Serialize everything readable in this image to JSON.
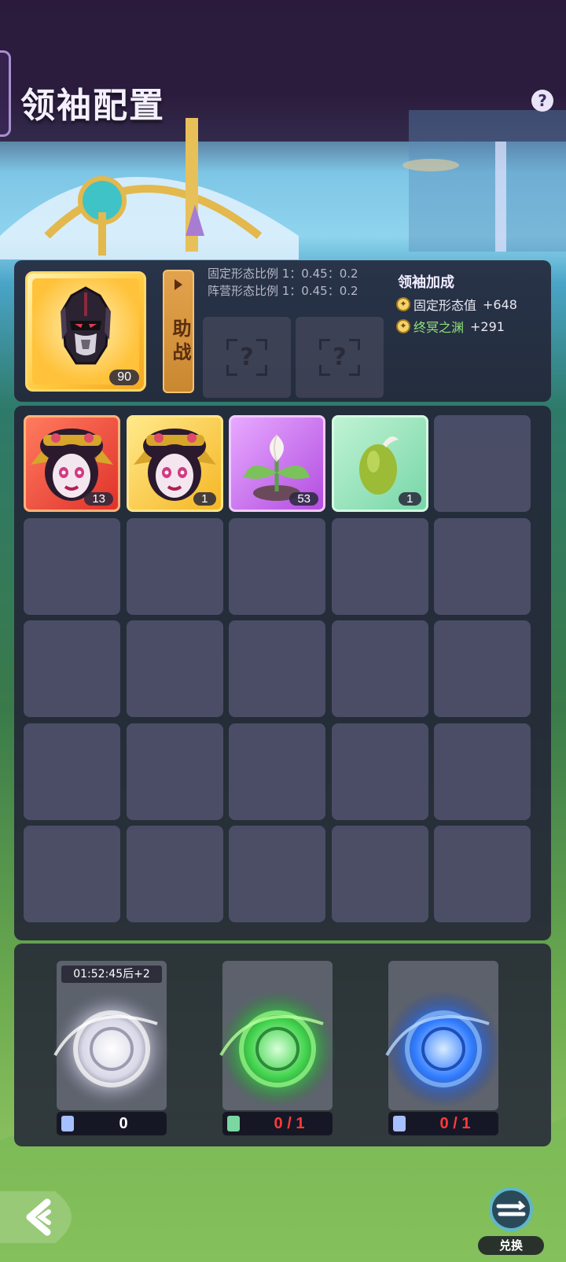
{
  "header": {
    "title": "领袖配置",
    "help_symbol": "?"
  },
  "leader": {
    "level": "90",
    "assist_label": "助战",
    "ratio_fixed": "固定形态比例 1：0.45：0.2",
    "ratio_camp": "阵营形态比例 1：0.45：0.2",
    "empty_slot_symbol": "?"
  },
  "bonus": {
    "title": "领袖加成",
    "rows": [
      {
        "label": "固定形态值",
        "value": "+648",
        "label_color": "#e8e8f0"
      },
      {
        "label": "终冥之渊",
        "value": "+291",
        "label_color": "#8fe07a"
      }
    ]
  },
  "inventory": {
    "items": [
      {
        "kind": "red",
        "art": "opera-girl",
        "count": "13"
      },
      {
        "kind": "gold",
        "art": "opera-girl",
        "count": "1"
      },
      {
        "kind": "purple",
        "art": "sprout-plant",
        "count": "53"
      },
      {
        "kind": "mint",
        "art": "green-seed",
        "count": "1"
      }
    ],
    "rows": 5,
    "cols": 5
  },
  "portals": [
    {
      "theme": "white",
      "timer": "01:52:45后+2",
      "count": "0",
      "count_color": "#ffffff"
    },
    {
      "theme": "green",
      "timer": "",
      "count": "0 / 1",
      "count_color": "#ff3b3b"
    },
    {
      "theme": "blue",
      "timer": "",
      "count": "0 / 1",
      "count_color": "#ff3b3b"
    }
  ],
  "footer": {
    "exchange_label": "兑换"
  }
}
